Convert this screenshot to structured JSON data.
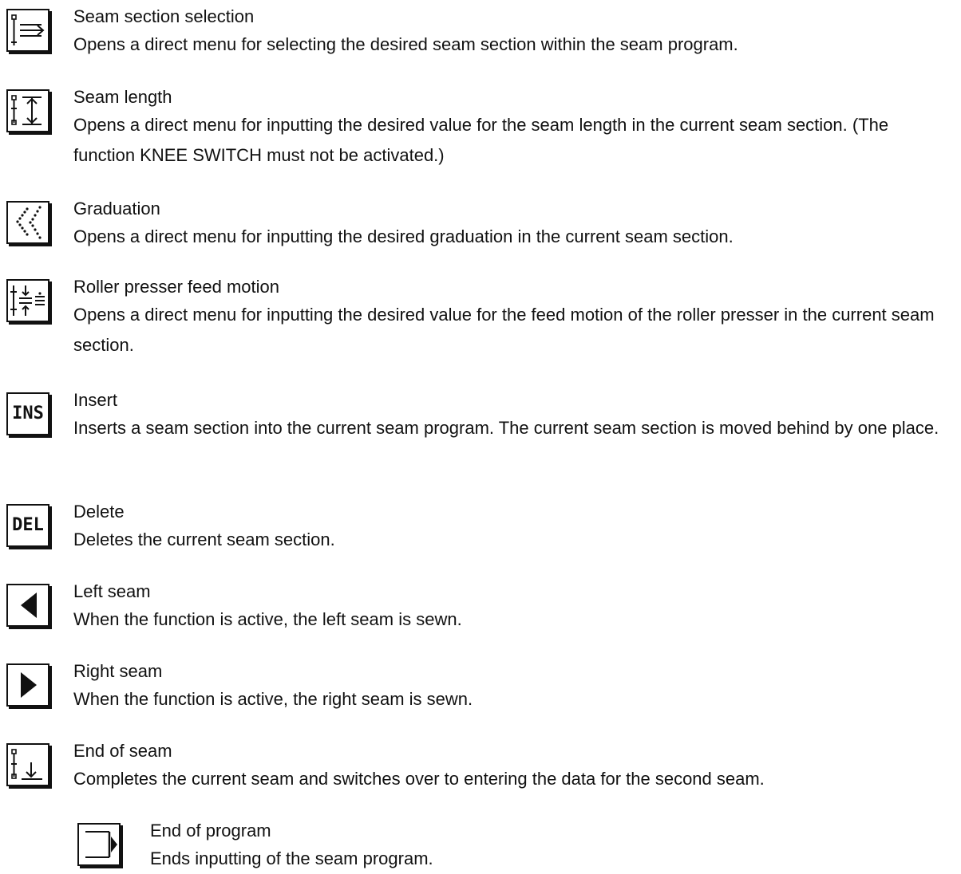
{
  "entries": [
    {
      "title": "Seam section selection",
      "desc": "Opens a direct menu for selecting the desired seam section within the seam program.",
      "icon": "seam-section-selection-icon"
    },
    {
      "title": "Seam length",
      "desc": "Opens a direct menu for inputting the desired value for the seam length in the current seam section. (The function KNEE SWITCH must not be activated.)",
      "icon": "seam-length-icon"
    },
    {
      "title": "Graduation",
      "desc": "Opens a direct menu for inputting the desired graduation in the current seam section.",
      "icon": "graduation-icon"
    },
    {
      "title": "Roller presser feed motion",
      "desc": "Opens a direct menu for inputting the desired value for the feed motion of the roller presser in the current seam section.",
      "icon": "roller-presser-feed-icon"
    },
    {
      "title": "Insert",
      "desc": "Inserts a seam section into the current seam program. The current seam section is moved behind by one place.",
      "icon": "insert-icon",
      "icon_text": "INS"
    },
    {
      "title": "Delete",
      "desc": "Deletes the current seam section.",
      "icon": "delete-icon",
      "icon_text": "DEL"
    },
    {
      "title": "Left seam",
      "desc": "When the function is active, the left seam is sewn.",
      "icon": "left-seam-icon"
    },
    {
      "title": "Right seam",
      "desc": "When the function is active, the right seam is sewn.",
      "icon": "right-seam-icon"
    },
    {
      "title": "End of seam",
      "desc": "Completes the current seam and switches over to entering the data for the second seam.",
      "icon": "end-of-seam-icon"
    },
    {
      "title": "End of program",
      "desc": "Ends inputting of the seam program.",
      "icon": "end-of-program-icon"
    }
  ]
}
